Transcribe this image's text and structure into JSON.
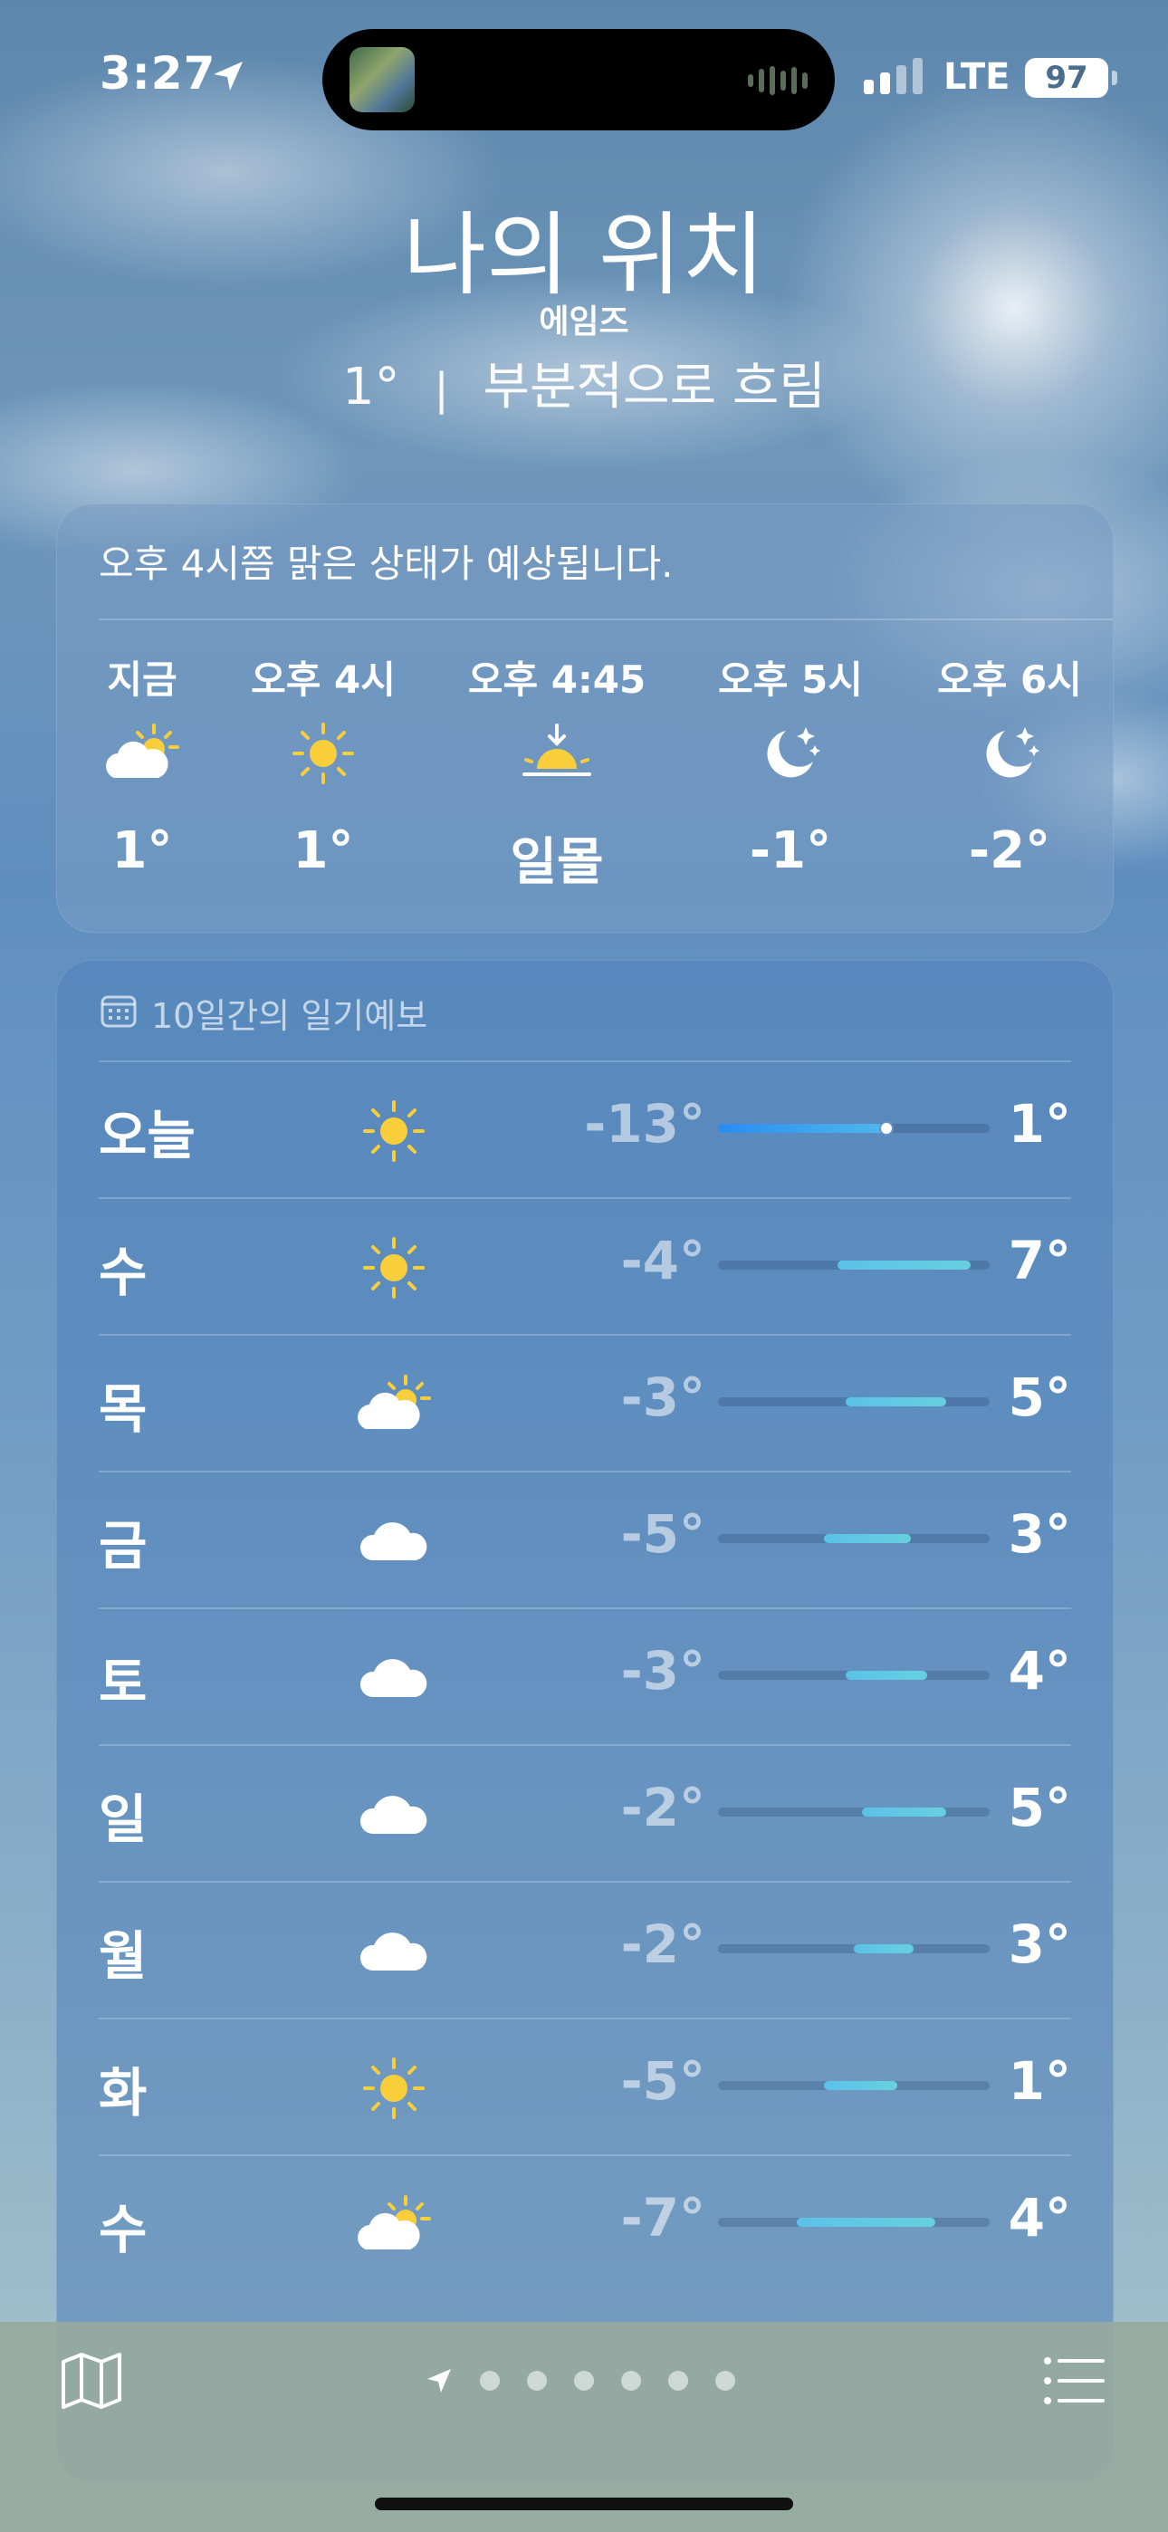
{
  "status_bar": {
    "time": "3:27",
    "network": "LTE",
    "battery": "97"
  },
  "header": {
    "city": "나의 위치",
    "region": "에임즈",
    "temperature": "1°",
    "separator": "|",
    "condition": "부분적으로 흐림"
  },
  "hourly": {
    "summary": "오후 4시쯤 맑은 상태가 예상됩니다.",
    "items": [
      {
        "label": "지금",
        "icon": "partly-cloudy-icon",
        "value": "1°"
      },
      {
        "label": "오후 4시",
        "icon": "sun-icon",
        "value": "1°"
      },
      {
        "label": "오후 4:45",
        "icon": "sunset-icon",
        "value": "일몰"
      },
      {
        "label": "오후 5시",
        "icon": "moon-stars-icon",
        "value": "-1°"
      },
      {
        "label": "오후 6시",
        "icon": "moon-stars-icon",
        "value": "-2°"
      }
    ]
  },
  "daily": {
    "title": "10일간의 일기예보",
    "days": [
      {
        "day": "오늘",
        "icon": "sun-icon",
        "low": "-13°",
        "high": "1°",
        "range_start": 0.0,
        "range_end": 0.62,
        "current": 0.62
      },
      {
        "day": "수",
        "icon": "sun-icon",
        "low": "-4°",
        "high": "7°",
        "range_start": 0.44,
        "range_end": 0.93
      },
      {
        "day": "목",
        "icon": "partly-cloudy-icon",
        "low": "-3°",
        "high": "5°",
        "range_start": 0.47,
        "range_end": 0.84
      },
      {
        "day": "금",
        "icon": "cloud-icon",
        "low": "-5°",
        "high": "3°",
        "range_start": 0.39,
        "range_end": 0.71
      },
      {
        "day": "토",
        "icon": "cloud-icon",
        "low": "-3°",
        "high": "4°",
        "range_start": 0.47,
        "range_end": 0.77
      },
      {
        "day": "일",
        "icon": "cloud-icon",
        "low": "-2°",
        "high": "5°",
        "range_start": 0.53,
        "range_end": 0.84
      },
      {
        "day": "월",
        "icon": "cloud-icon",
        "low": "-2°",
        "high": "3°",
        "range_start": 0.5,
        "range_end": 0.72
      },
      {
        "day": "화",
        "icon": "sun-icon",
        "low": "-5°",
        "high": "1°",
        "range_start": 0.39,
        "range_end": 0.66
      },
      {
        "day": "수",
        "icon": "partly-cloudy-icon",
        "low": "-7°",
        "high": "4°",
        "range_start": 0.29,
        "range_end": 0.8
      }
    ]
  },
  "toolbar": {
    "left_icon": "map-icon",
    "right_icon": "list-icon",
    "page_count": 6
  }
}
